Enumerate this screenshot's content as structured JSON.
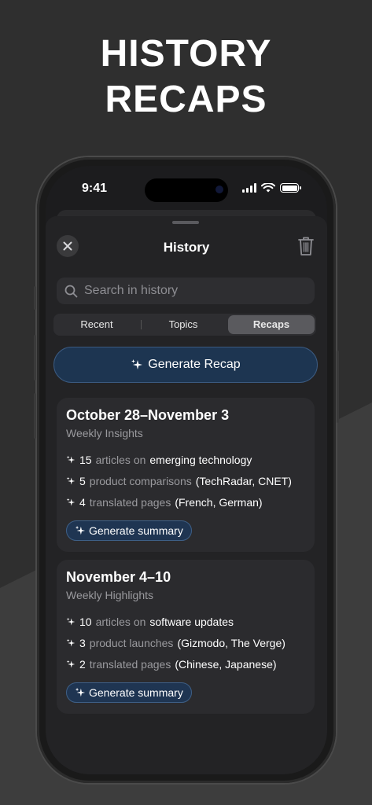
{
  "headline": [
    "HISTORY",
    "RECAPS"
  ],
  "status_bar": {
    "time": "9:41"
  },
  "sheet": {
    "title": "History"
  },
  "search": {
    "placeholder": "Search in history"
  },
  "tabs": [
    {
      "label": "Recent",
      "active": false
    },
    {
      "label": "Topics",
      "active": false
    },
    {
      "label": "Recaps",
      "active": true
    }
  ],
  "generate_recap_label": "Generate Recap",
  "cards": [
    {
      "title": "October 28–November 3",
      "subtitle": "Weekly Insights",
      "items": [
        {
          "count": "15",
          "muted": "articles on",
          "text": "emerging technology"
        },
        {
          "count": "5",
          "muted": "product comparisons",
          "text": "(TechRadar, CNET)"
        },
        {
          "count": "4",
          "muted": "translated pages",
          "text": "(French, German)"
        }
      ],
      "button_label": "Generate summary"
    },
    {
      "title": "November 4–10",
      "subtitle": "Weekly Highlights",
      "items": [
        {
          "count": "10",
          "muted": "articles on",
          "text": "software updates"
        },
        {
          "count": "3",
          "muted": "product launches",
          "text": "(Gizmodo, The Verge)"
        },
        {
          "count": "2",
          "muted": "translated pages",
          "text": "(Chinese, Japanese)"
        }
      ],
      "button_label": "Generate summary"
    }
  ],
  "colors": {
    "accent_button": "#1d3551",
    "accent_border": "#3b5a80",
    "muted_text": "#9a9a9e",
    "card_bg": "#2b2b2e"
  },
  "icons": [
    "close-icon",
    "trash-icon",
    "search-icon",
    "sparkles-icon",
    "signal-icon",
    "wifi-icon",
    "battery-icon"
  ]
}
